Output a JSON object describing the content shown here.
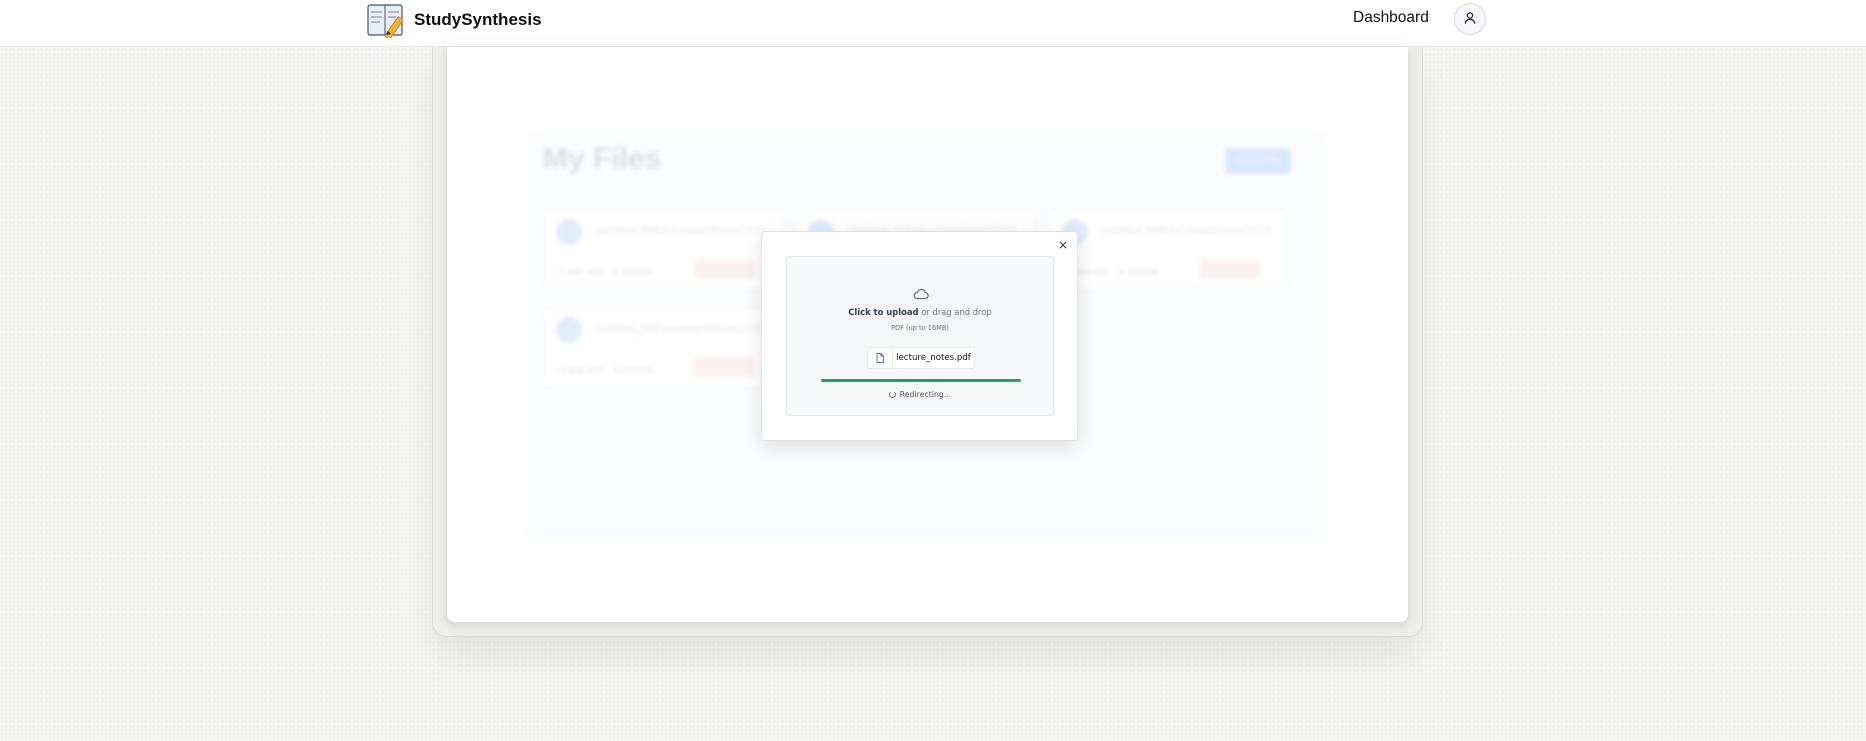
{
  "navbar": {
    "brand_name": "StudySynthesis",
    "logo_icon": "notebook-pencil-icon",
    "dashboard_link": "Dashboard",
    "profile_icon": "user-icon"
  },
  "background_page": {
    "title": "My Files",
    "upload_button": "Upload File",
    "file_cards": [
      {
        "name": "Untitled_PDFdocumentNotes1772..."
      },
      {
        "name": "Untitled_PDFdocumentNotes1772..."
      },
      {
        "name": "Untitled_PDFdocumentNotes1772..."
      },
      {
        "name": "Untitled_PDFdocumentNotes1772..."
      }
    ]
  },
  "upload_modal": {
    "close_label": "×",
    "cloud_icon": "cloud-icon",
    "click_to_upload": "Click to upload",
    "drag_drop_text": "or drag and drop",
    "file_hint": "PDF (up to 16MB)",
    "file_icon": "file-icon",
    "file_name": "lecture_notes.pdf",
    "progress_percent": 100,
    "progress_color": "#22a35a",
    "status_text": "Redirecting..."
  }
}
